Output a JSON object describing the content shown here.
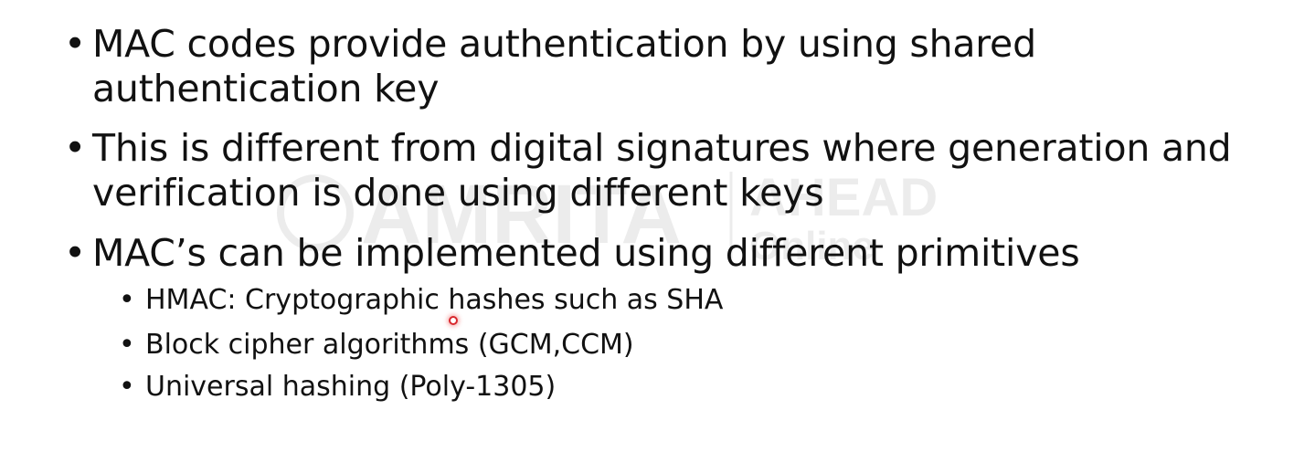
{
  "slide": {
    "bullets": [
      {
        "dot": "•",
        "text": "MAC codes provide authentication by using shared authentication key"
      },
      {
        "dot": "•",
        "text": "This is different from digital signatures where generation and verification is done using different keys"
      },
      {
        "dot": "•",
        "text": "MAC’s can be implemented using different primitives"
      }
    ],
    "sub_bullets": [
      {
        "dot": "•",
        "text": "HMAC: Cryptographic hashes such as SHA"
      },
      {
        "dot": "•",
        "text": "Block cipher algorithms (GCM,CCM)"
      },
      {
        "dot": "•",
        "text": "Universal hashing (Poly-1305)"
      }
    ]
  },
  "watermark": {
    "brand_left": "AMRITA",
    "brand_right": "AHEAD",
    "brand_sub": "Online"
  },
  "cursor": {
    "icon": "pointer-dot-icon",
    "color": "#d8262b"
  }
}
